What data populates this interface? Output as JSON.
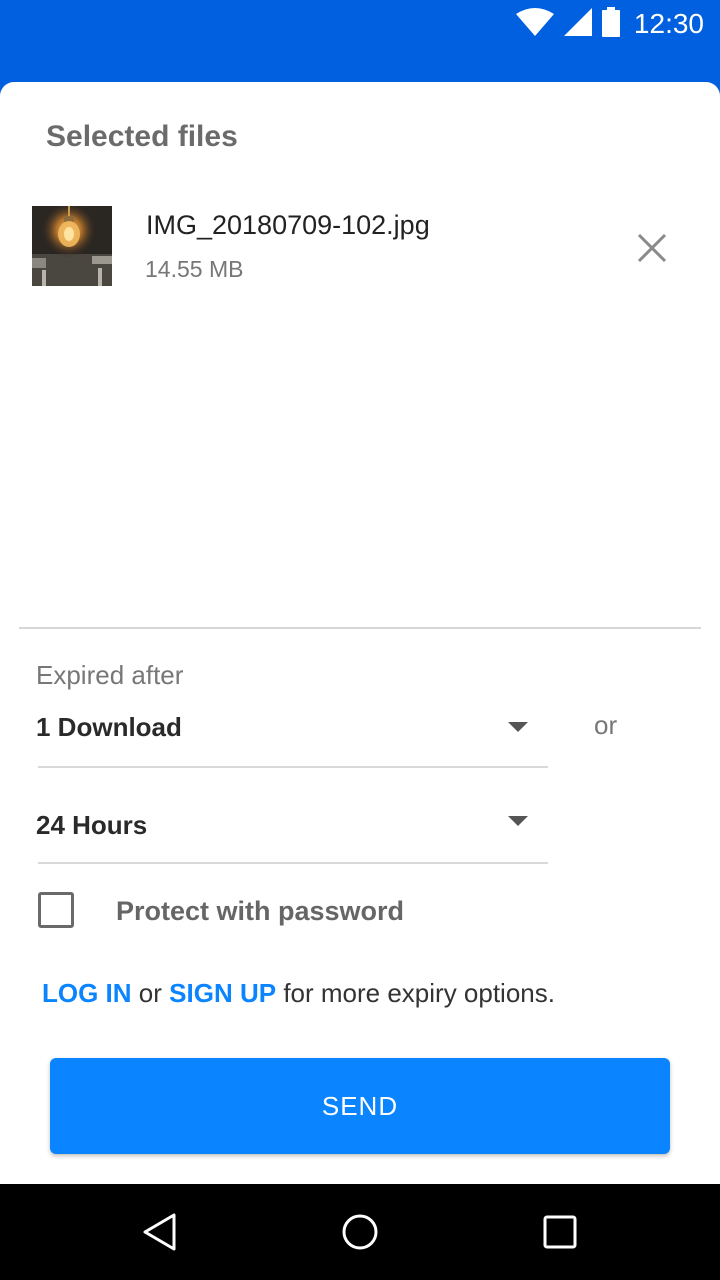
{
  "status_bar": {
    "time": "12:30",
    "icons": [
      "wifi-icon",
      "signal-icon",
      "battery-icon"
    ]
  },
  "selected_files": {
    "title": "Selected files",
    "files": [
      {
        "name": "IMG_20180709-102.jpg",
        "size": "14.55 MB",
        "thumbnail": "light-bulb-photo"
      }
    ]
  },
  "expiry": {
    "label": "Expired after",
    "downloads_value": "1 Download",
    "or_label": "or",
    "time_value": "24 Hours"
  },
  "password": {
    "label": "Protect with password",
    "checked": false
  },
  "promo": {
    "login": "LOG IN",
    "or": "or",
    "signup": "SIGN UP",
    "suffix": "for more expiry options."
  },
  "send_label": "SEND",
  "nav": [
    "back-icon",
    "home-icon",
    "recents-icon"
  ],
  "colors": {
    "header_blue": "#0060df",
    "accent_blue": "#0a84ff",
    "nav_black": "#000000"
  }
}
